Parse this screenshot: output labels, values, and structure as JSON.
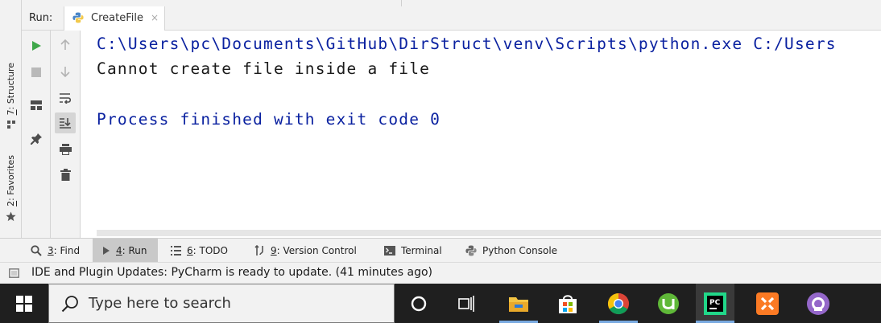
{
  "window": {
    "run_label": "Run:",
    "tab": {
      "name": "CreateFile",
      "close": "×"
    }
  },
  "left_strip": {
    "structure_tab": {
      "number": "7",
      "label": ": Structure"
    },
    "favorites_tab": {
      "number": "2",
      "label": ": Favorites"
    }
  },
  "console": {
    "lines": [
      {
        "text": "C:\\Users\\pc\\Documents\\GitHub\\DirStruct\\venv\\Scripts\\python.exe C:/Users",
        "color": "#0a21a0"
      },
      {
        "text": "Cannot create file inside a file",
        "color": "#1a1a1a"
      },
      {
        "text": "",
        "color": "#1a1a1a"
      },
      {
        "text": "Process finished with exit code 0",
        "color": "#0a21a0"
      }
    ]
  },
  "tool_windows": [
    {
      "number": "3",
      "label": ": Find",
      "icon": "search-icon",
      "active": false
    },
    {
      "number": "4",
      "label": ": Run",
      "icon": "run-icon",
      "active": true
    },
    {
      "number": "6",
      "label": ": TODO",
      "icon": "todo-list-icon",
      "active": false
    },
    {
      "number": "9",
      "label": ": Version Control",
      "icon": "version-control-icon",
      "active": false
    },
    {
      "number": "",
      "label": "Terminal",
      "icon": "terminal-icon",
      "active": false
    },
    {
      "number": "",
      "label": "Python Console",
      "icon": "python-icon",
      "active": false
    }
  ],
  "status": {
    "message": "IDE and Plugin Updates: PyCharm is ready to update. (41 minutes ago)"
  },
  "taskbar": {
    "search_placeholder": "Type here to search",
    "apps": [
      "cortana-icon",
      "task-view-icon",
      "file-explorer-icon",
      "microsoft-store-icon",
      "chrome-icon",
      "utorrent-icon",
      "pycharm-icon",
      "xampp-icon",
      "github-desktop-icon"
    ]
  },
  "colors": {
    "console_path": "#0a21a0",
    "run_green": "#3fa84a",
    "taskbar": "#1f1f1f",
    "ide_panel": "#f2f2f2"
  }
}
